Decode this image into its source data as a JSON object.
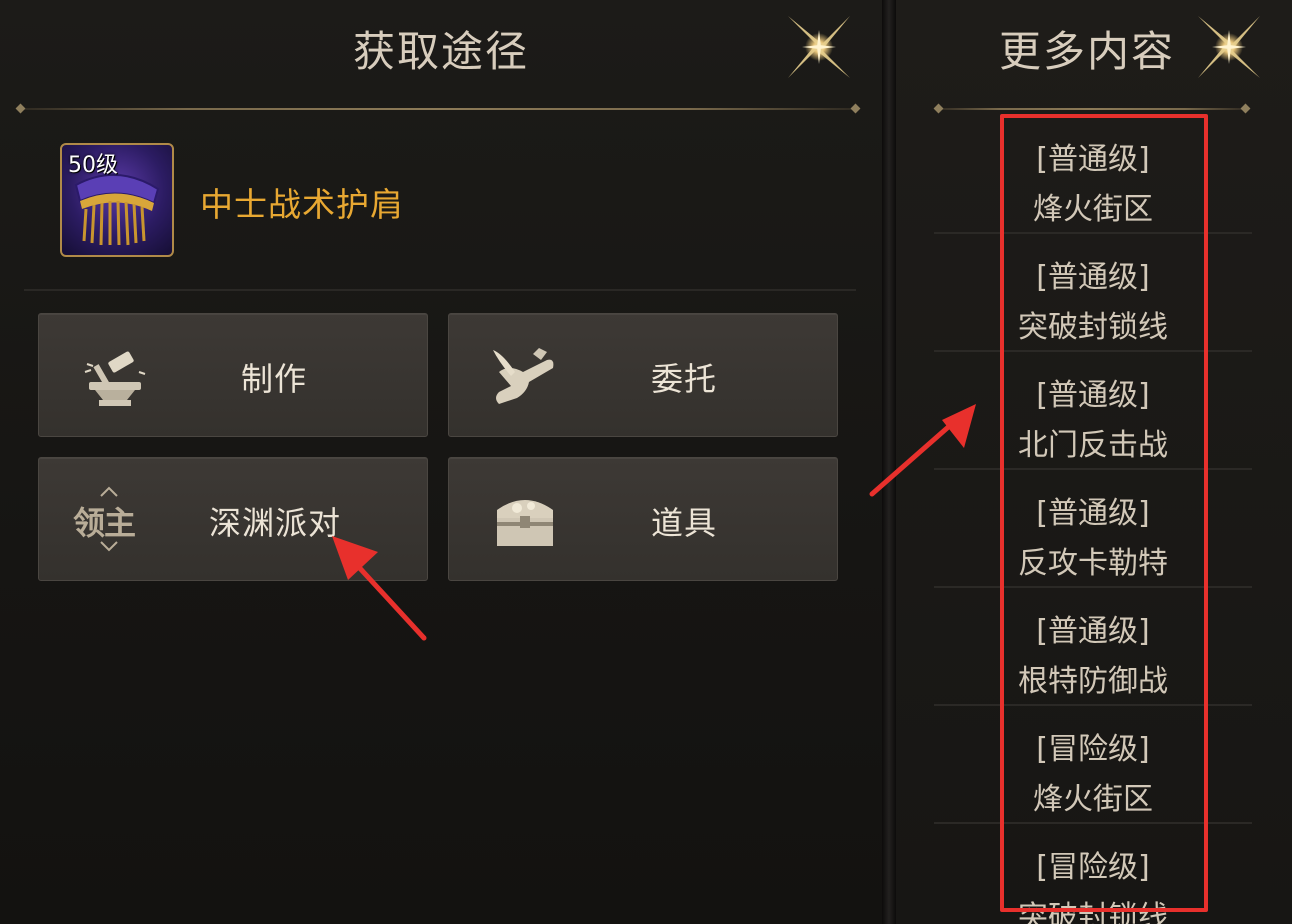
{
  "left_panel": {
    "title": "获取途径",
    "item": {
      "level": "50级",
      "name": "中士战术护肩"
    },
    "buttons": [
      {
        "label": "制作",
        "icon": "anvil-hammer-icon"
      },
      {
        "label": "委托",
        "icon": "scroll-quill-icon"
      },
      {
        "label": "深渊派对",
        "badge": "领主",
        "icon": "lord-badge-icon"
      },
      {
        "label": "道具",
        "icon": "treasure-chest-icon"
      }
    ]
  },
  "right_panel": {
    "title": "更多内容",
    "items": [
      {
        "tier": "[普通级]",
        "stage": "烽火街区"
      },
      {
        "tier": "[普通级]",
        "stage": "突破封锁线"
      },
      {
        "tier": "[普通级]",
        "stage": "北门反击战"
      },
      {
        "tier": "[普通级]",
        "stage": "反攻卡勒特"
      },
      {
        "tier": "[普通级]",
        "stage": "根特防御战"
      },
      {
        "tier": "[冒险级]",
        "stage": "烽火街区"
      },
      {
        "tier": "[冒险级]",
        "stage": "突破封锁线"
      }
    ]
  },
  "colors": {
    "item_name": "#e8a832",
    "annotation_red": "#e8302c",
    "gold_accent": "#8d7b58"
  }
}
